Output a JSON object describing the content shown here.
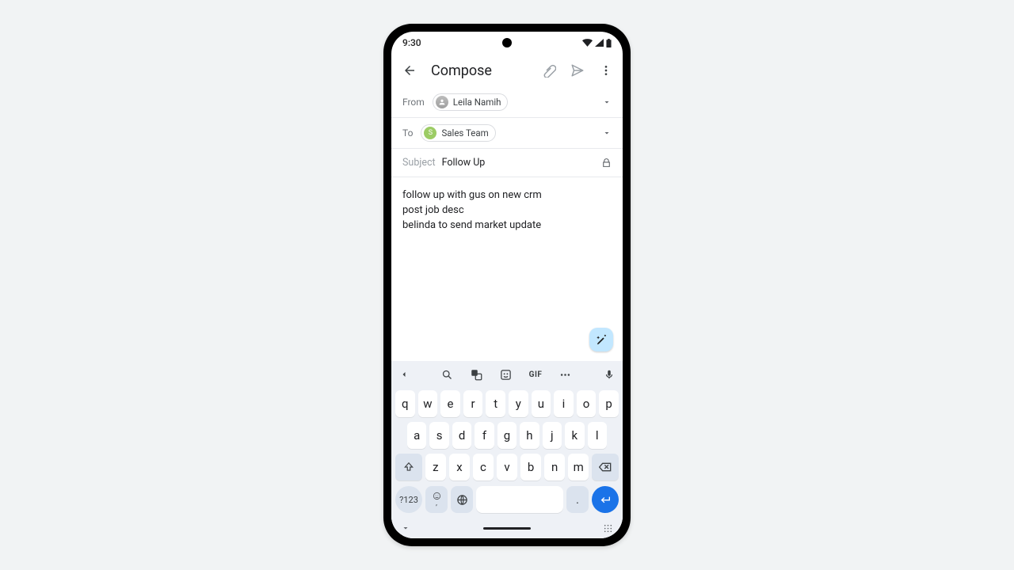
{
  "status": {
    "time": "9:30"
  },
  "appbar": {
    "title": "Compose"
  },
  "from": {
    "label": "From",
    "chip": "Leila Namih"
  },
  "to": {
    "label": "To",
    "chip": "Sales Team",
    "initial": "S"
  },
  "subject": {
    "label": "Subject",
    "value": "Follow Up"
  },
  "body": {
    "line1": "follow up with gus on new crm",
    "line2": "post job desc",
    "line3": "belinda to send market update"
  },
  "keyboard": {
    "strip_gif": "GIF",
    "row1": [
      "q",
      "w",
      "e",
      "r",
      "t",
      "y",
      "u",
      "i",
      "o",
      "p"
    ],
    "row2": [
      "a",
      "s",
      "d",
      "f",
      "g",
      "h",
      "j",
      "k",
      "l"
    ],
    "row3": [
      "z",
      "x",
      "c",
      "v",
      "b",
      "n",
      "m"
    ],
    "sym": "?123",
    "comma": ",",
    "period": "."
  }
}
